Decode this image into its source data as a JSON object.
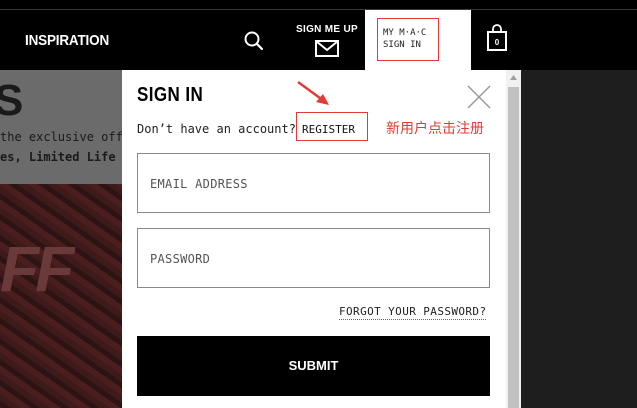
{
  "header": {
    "nav_inspiration": "INSPIRATION",
    "search_icon": "search-icon",
    "signup_label": "SIGN ME UP",
    "signup_icon": "mail-icon",
    "mymac_line1": "MY M·A·C",
    "mymac_line2": "SIGN IN",
    "cart_count": "0",
    "cart_icon": "shopping-bag-icon"
  },
  "background": {
    "heading": "S",
    "text_line1": "the exclusive offe",
    "text_line2": "es, Limited Life",
    "banner_text": "FF"
  },
  "modal": {
    "title": "SIGN IN",
    "no_account_text": "Don’t have an account?",
    "register_label": "REGISTER",
    "email_placeholder": "EMAIL ADDRESS",
    "password_placeholder": "PASSWORD",
    "forgot_label": "FORGOT YOUR PASSWORD?",
    "submit_label": "SUBMIT",
    "close_icon": "close-icon"
  },
  "annotation": {
    "text": "新用户点击注册",
    "color": "#e23b35"
  },
  "colors": {
    "accent_red": "#e23b35",
    "header_bg": "#000000",
    "button_bg": "#000000"
  }
}
